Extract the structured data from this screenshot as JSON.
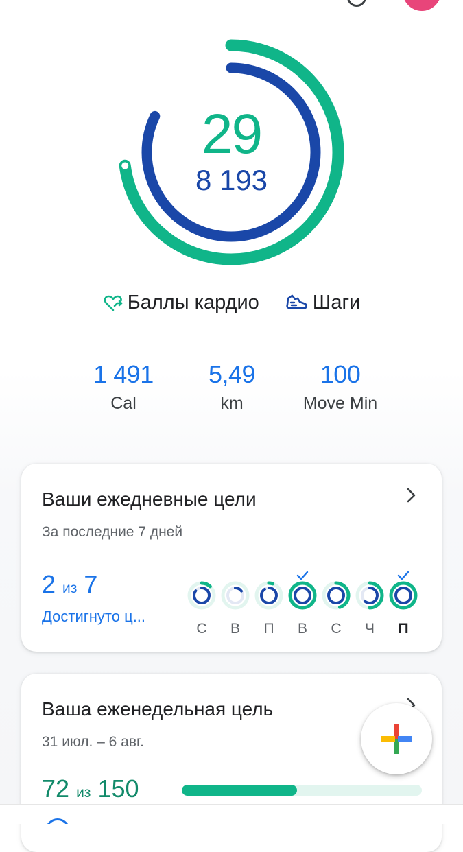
{
  "header": {
    "help_icon": "help-icon",
    "avatar_icon": "avatar",
    "avatar_color": "#e8457a"
  },
  "ring": {
    "primary_value": "29",
    "secondary_value": "8 193",
    "outer_color": "#10b589",
    "inner_color": "#1a47a8",
    "outer_progress": 0.73,
    "inner_progress": 0.82
  },
  "legend": {
    "cardio_label": "Баллы кардио",
    "steps_label": "Шаги",
    "cardio_icon": "heart-arrow-icon",
    "steps_icon": "shoe-icon"
  },
  "stats": [
    {
      "value": "1 491",
      "label": "Cal"
    },
    {
      "value": "5,49",
      "label": "km"
    },
    {
      "value": "100",
      "label": "Move Min"
    }
  ],
  "daily_goals": {
    "title": "Ваши ежедневные цели",
    "subtitle": "За последние 7 дней",
    "achieved": "2",
    "separator": "из",
    "total": "7",
    "link": "Достигнуто ц...",
    "days": [
      {
        "label": "С",
        "outer": 0.12,
        "inner": 0.85,
        "check": false,
        "today": false
      },
      {
        "label": "В",
        "outer": 0.0,
        "inner": 0.15,
        "check": false,
        "today": false
      },
      {
        "label": "П",
        "outer": 0.05,
        "inner": 0.9,
        "check": false,
        "today": false
      },
      {
        "label": "В",
        "outer": 1.0,
        "inner": 1.0,
        "check": true,
        "today": false
      },
      {
        "label": "С",
        "outer": 0.45,
        "inner": 1.0,
        "check": false,
        "today": false
      },
      {
        "label": "Ч",
        "outer": 0.5,
        "inner": 0.6,
        "check": false,
        "today": false
      },
      {
        "label": "П",
        "outer": 1.0,
        "inner": 1.0,
        "check": true,
        "today": true
      }
    ]
  },
  "weekly_goal": {
    "title": "Ваша еженедельная цель",
    "subtitle": "31 июл. – 6 авг.",
    "current": "72",
    "separator": "из",
    "target": "150",
    "progress": 0.48
  },
  "fab": {
    "icon": "add-icon"
  },
  "nav": {
    "icon": "home-icon"
  }
}
